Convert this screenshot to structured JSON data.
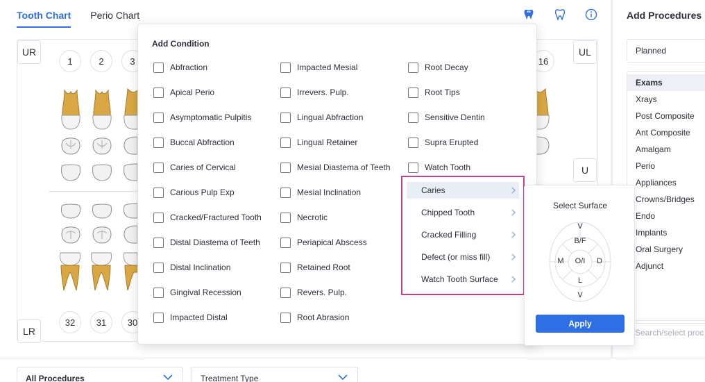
{
  "tabs": [
    {
      "label": "Tooth Chart",
      "active": true
    },
    {
      "label": "Perio Chart",
      "active": false
    }
  ],
  "header_icons": [
    "tooth-filled-icon",
    "tooth-outline-icon",
    "info-icon"
  ],
  "chart": {
    "corners": {
      "upper_right": "UR",
      "upper_left": "UL",
      "lower_right": "LR"
    },
    "upper_numbers": [
      "1",
      "2",
      "3"
    ],
    "upper_last": "16",
    "lower_numbers": [
      "32",
      "31",
      "30"
    ],
    "side_button": "U"
  },
  "add_condition": {
    "title": "Add Condition",
    "columns": [
      [
        "Abfraction",
        "Apical Perio",
        "Asymptomatic Pulpitis",
        "Buccal Abfraction",
        "Caries of Cervical",
        "Carious Pulp Exp",
        "Cracked/Fractured Tooth",
        "Distal Diastema of Teeth",
        "Distal Inclination",
        "Gingival Recession",
        "Impacted Distal"
      ],
      [
        "Impacted Mesial",
        "Irrevers. Pulp.",
        "Lingual Abfraction",
        "Lingual Retainer",
        "Mesial Diastema of Teeth",
        "Mesial Inclination",
        "Necrotic",
        "Periapical Abscess",
        "Retained Root",
        "Revers. Pulp.",
        "Root Abrasion"
      ],
      [
        "Root Decay",
        "Root Tips",
        "Sensitive Dentin",
        "Supra Erupted",
        "Watch Tooth"
      ]
    ],
    "submenu": [
      {
        "label": "Caries",
        "highlighted": true
      },
      {
        "label": "Chipped Tooth",
        "highlighted": false
      },
      {
        "label": "Cracked Filling",
        "highlighted": false
      },
      {
        "label": "Defect (or miss fill)",
        "highlighted": false
      },
      {
        "label": "Watch Tooth Surface",
        "highlighted": false
      }
    ]
  },
  "surface": {
    "title": "Select Surface",
    "labels": {
      "top": "V",
      "bf": "B/F",
      "m": "M",
      "oi": "O/I",
      "d": "D",
      "l": "L",
      "bottom": "V"
    },
    "apply_label": "Apply"
  },
  "right_panel": {
    "title": "Add Procedures",
    "status": "Planned",
    "items": [
      "Exams",
      "Xrays",
      "Post Composite",
      "Ant Composite",
      "Amalgam",
      "Perio",
      "Appliances",
      "Crowns/Bridges",
      "Endo",
      "Implants",
      "Oral Surgery",
      "Adjunct"
    ],
    "selected_index": 0,
    "search_placeholder": "Search/select proc"
  },
  "bottom": {
    "procedures_filter": "All Procedures",
    "treatment_type": "Treatment Type"
  },
  "colors": {
    "accent": "#2f6fe4",
    "highlight_border": "#c4448a"
  }
}
